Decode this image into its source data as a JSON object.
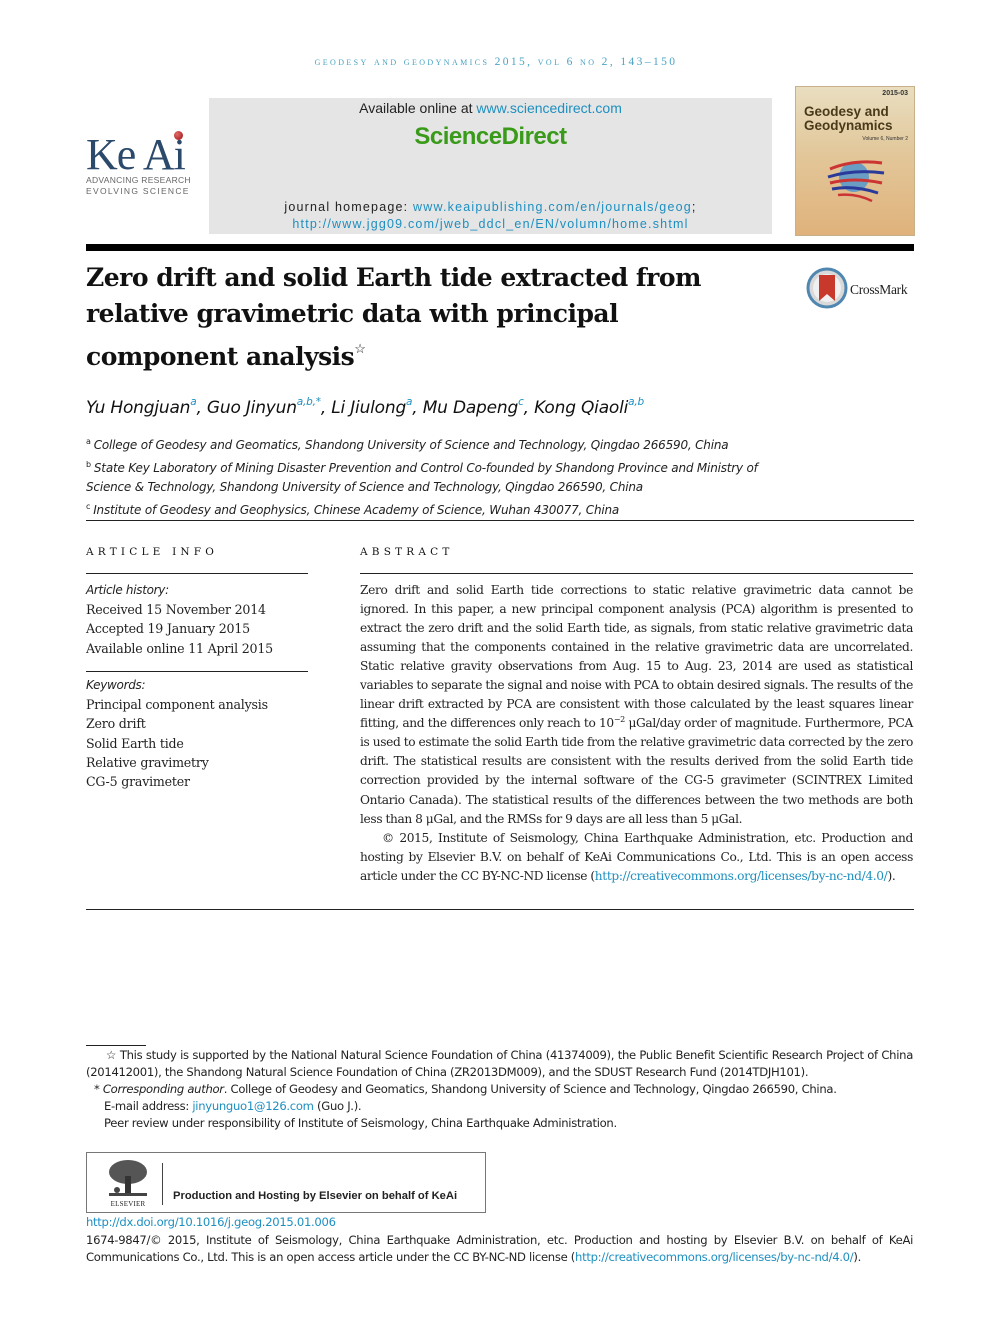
{
  "running_head": "GEODESY AND GEODYNAMICS 2015, VOL 6 NO 2, 143–150",
  "publisher_logo": {
    "wordmark": "Ke Ai",
    "tagline_1": "ADVANCING RESEARCH",
    "tagline_2": "EVOLVING SCIENCE"
  },
  "sciencedirect": {
    "available_prefix": "Available online at ",
    "available_link": "www.sciencedirect.com",
    "brand": "ScienceDirect",
    "homepage_label": "journal homepage: ",
    "homepage_link_1": "www.keaipublishing.com/en/journals/geog",
    "homepage_sep": ";",
    "homepage_link_2": "http://www.jgg09.com/jweb_ddcl_en/EN/volumn/home.shtml"
  },
  "cover": {
    "title_line_1": "Geodesy and",
    "title_line_2": "Geodynamics",
    "issue": "2015-03",
    "volume": "Volume 6, Number 2"
  },
  "article": {
    "title": "Zero drift and solid Earth tide extracted from relative gravimetric data with principal component analysis",
    "title_marker": "☆",
    "crossmark_label": "CrossMark",
    "authors": [
      {
        "name": "Yu Hongjuan",
        "aff": "a"
      },
      {
        "name": "Guo Jinyun",
        "aff": "a,b,*"
      },
      {
        "name": "Li Jiulong",
        "aff": "a"
      },
      {
        "name": "Mu Dapeng",
        "aff": "c"
      },
      {
        "name": "Kong Qiaoli",
        "aff": "a,b"
      }
    ],
    "affiliations": [
      {
        "key": "a",
        "text": "College of Geodesy and Geomatics, Shandong University of Science and Technology, Qingdao 266590, China"
      },
      {
        "key": "b",
        "text": "State Key Laboratory of Mining Disaster Prevention and Control Co-founded by Shandong Province and Ministry of Science & Technology, Shandong University of Science and Technology, Qingdao 266590, China"
      },
      {
        "key": "c",
        "text": "Institute of Geodesy and Geophysics, Chinese Academy of Science, Wuhan 430077, China"
      }
    ]
  },
  "article_info": {
    "heading": "ARTICLE INFO",
    "history_label": "Article history:",
    "received": "Received 15 November 2014",
    "accepted": "Accepted 19 January 2015",
    "available": "Available online 11 April 2015",
    "keywords_label": "Keywords:",
    "keywords": [
      "Principal component analysis",
      "Zero drift",
      "Solid Earth tide",
      "Relative gravimetry",
      "CG-5 gravimeter"
    ]
  },
  "abstract": {
    "heading": "ABSTRACT",
    "text_before_exp": "Zero drift and solid Earth tide corrections to static relative gravimetric data cannot be ignored. In this paper, a new principal component analysis (PCA) algorithm is presented to extract the zero drift and the solid Earth tide, as signals, from static relative gravimetric data assuming that the components contained in the relative gravimetric data are uncorrelated. Static relative gravity observations from Aug. 15 to Aug. 23, 2014 are used as statistical variables to separate the signal and noise with PCA to obtain desired signals. The results of the linear drift extracted by PCA are consistent with those calculated by the least squares linear fitting, and the differences only reach to 10",
    "exponent": "−2",
    "text_after_exp": " μGal/day order of magnitude. Furthermore, PCA is used to estimate the solid Earth tide from the relative gravimetric data corrected by the zero drift. The statistical results are consistent with the results derived from the solid Earth tide correction provided by the internal software of the CG-5 gravimeter (SCINTREX Limited Ontario Canada). The statistical results of the differences between the two methods are both less than 8 μGal, and the RMSs for 9 days are all less than 5 μGal.",
    "copyright_text": "© 2015, Institute of Seismology, China Earthquake Administration, etc. Production and hosting by Elsevier B.V. on behalf of KeAi Communications Co., Ltd. This is an open access article under the CC BY-NC-ND license (",
    "license_link": "http://creativecommons.org/licenses/by-nc-nd/4.0/",
    "copyright_end": ")."
  },
  "footnotes": {
    "funding_marker": "☆",
    "funding": "This study is supported by the National Natural Science Foundation of China (41374009), the Public Benefit Scientific Research Project of China (201412001), the Shandong Natural Science Foundation of China (ZR2013DM009), and the SDUST Research Fund (2014TDJH101).",
    "corresponding_marker": "*",
    "corresponding_label": "Corresponding author",
    "corresponding_text": ". College of Geodesy and Geomatics, Shandong University of Science and Technology, Qingdao 266590, China.",
    "email_label": "E-mail address: ",
    "email": "jinyunguo1@126.com",
    "email_suffix": " (Guo J.).",
    "peer_review": "Peer review under responsibility of Institute of Seismology, China Earthquake Administration."
  },
  "elsevier": {
    "wordmark": "ELSEVIER",
    "text": "Production and Hosting by Elsevier on behalf of KeAi"
  },
  "doi_link": "http://dx.doi.org/10.1016/j.geog.2015.01.006",
  "issn_text": "1674-9847/© 2015, Institute of Seismology, China Earthquake Administration, etc. Production and hosting by Elsevier B.V. on behalf of KeAi Communications Co., Ltd. This is an open access article under the CC BY-NC-ND license (",
  "issn_link": "http://creativecommons.org/licenses/by-nc-nd/4.0/",
  "issn_end": ").",
  "colors": {
    "link": "#1d8fc0",
    "running_head": "#4aa3c4",
    "sciencedirect_green": "#3a9a1a",
    "header_box": "#e5e5e5",
    "keai_blue": "#2b4a6b"
  }
}
